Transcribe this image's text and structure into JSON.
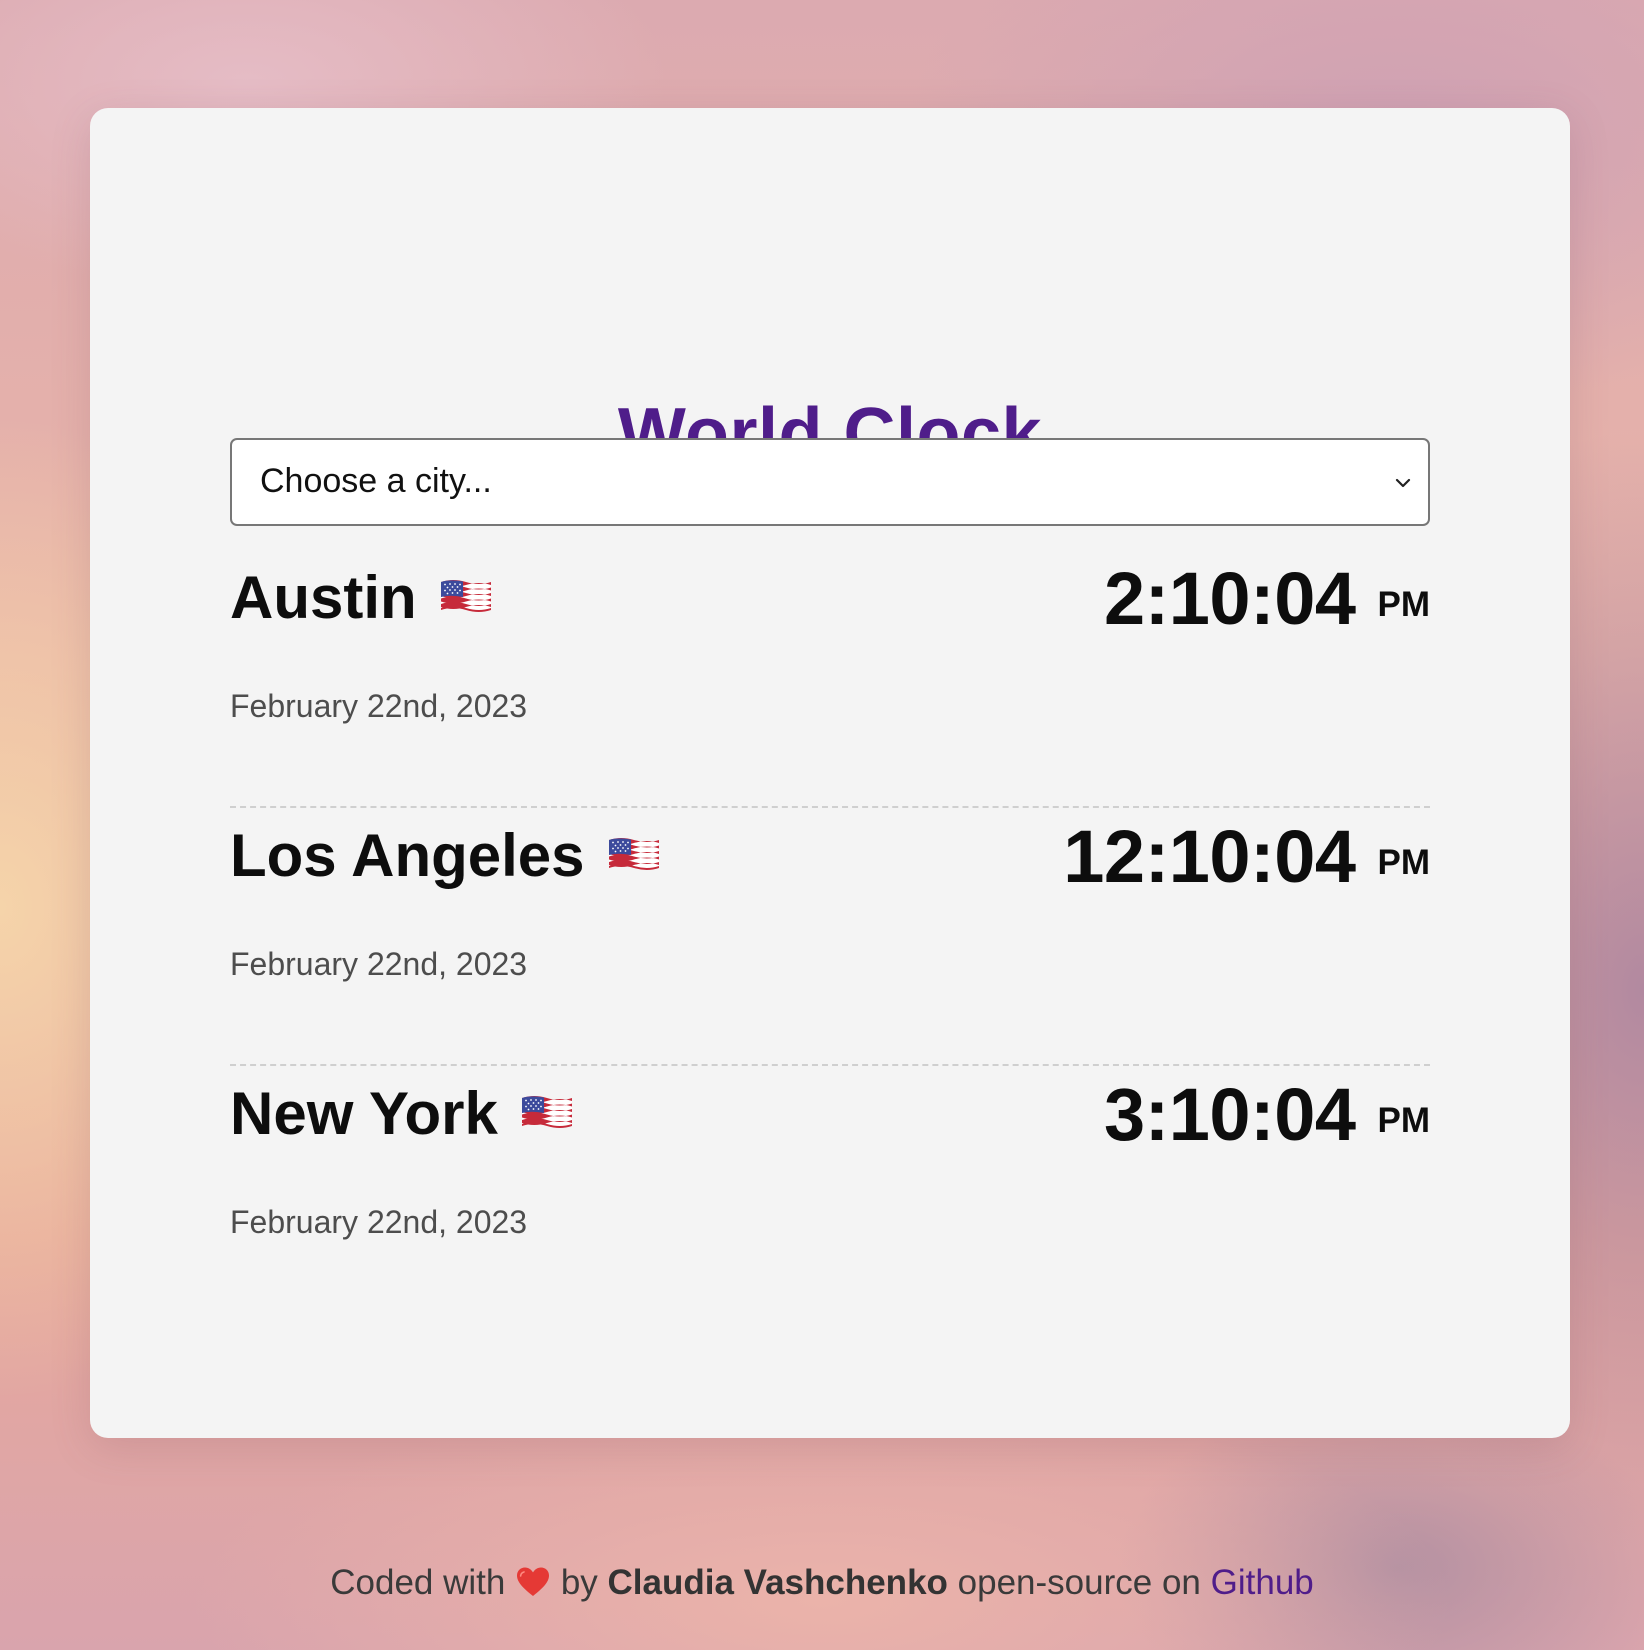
{
  "app": {
    "title": "World Clock"
  },
  "city_select": {
    "selected": "Choose a city...",
    "icon": "chevron-down-icon"
  },
  "cities": [
    {
      "name": "Austin",
      "flag": "us-flag-icon",
      "time": "2:10:04",
      "ampm": "PM",
      "date": "February 22nd, 2023"
    },
    {
      "name": "Los Angeles",
      "flag": "us-flag-icon",
      "time": "12:10:04",
      "ampm": "PM",
      "date": "February 22nd, 2023"
    },
    {
      "name": "New York",
      "flag": "us-flag-icon",
      "time": "3:10:04",
      "ampm": "PM",
      "date": "February 22nd, 2023"
    }
  ],
  "footer": {
    "prefix": "Coded with",
    "heart_icon": "heart-icon",
    "by": "by",
    "author": "Claudia Vashchenko",
    "middle": "open-source on",
    "link_label": "Github"
  },
  "colors": {
    "accent": "#4f1d8a",
    "card_background": "#f4f4f4",
    "heart": "#e53935"
  }
}
